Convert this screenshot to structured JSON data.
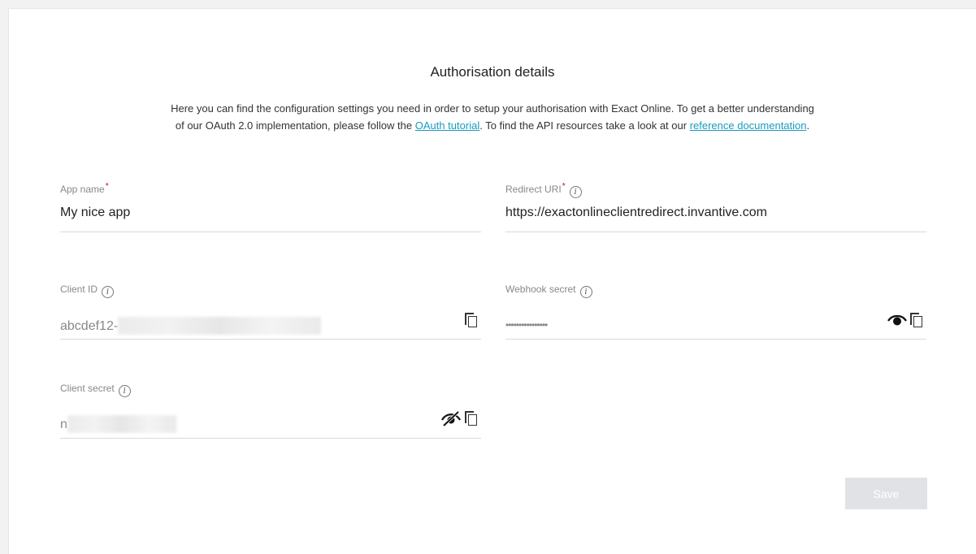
{
  "header": {
    "title": "Authorisation details",
    "intro_line1": "Here you can find the configuration settings you need in order to setup your authorisation with Exact Online. To get a better understanding",
    "intro_line2_prefix": "of our OAuth 2.0 implementation, please follow the ",
    "oauth_link": "OAuth tutorial",
    "intro_line2_middle": ". To find the API resources take a look at our ",
    "reference_link": "reference documentation",
    "intro_line2_suffix": "."
  },
  "fields": {
    "app_name": {
      "label": "App name",
      "required_mark": "*",
      "value": "My nice app"
    },
    "redirect_uri": {
      "label": "Redirect URI",
      "required_mark": "*",
      "value": "https://exactonlineclientredirect.invantive.com"
    },
    "client_id": {
      "label": "Client ID",
      "value_visible": "abcdef12-"
    },
    "webhook_secret": {
      "label": "Webhook secret",
      "value_masked": "••••••••••••••••"
    },
    "client_secret": {
      "label": "Client secret",
      "value_visible": "n"
    }
  },
  "icons": {
    "info": "info-icon",
    "copy": "copy-icon",
    "eye": "eye-icon",
    "eye_off": "eye-off-icon"
  },
  "actions": {
    "save_label": "Save"
  },
  "colors": {
    "link": "#1a9bbd",
    "required": "#d0021b",
    "save_disabled": "#e0e2e5"
  }
}
